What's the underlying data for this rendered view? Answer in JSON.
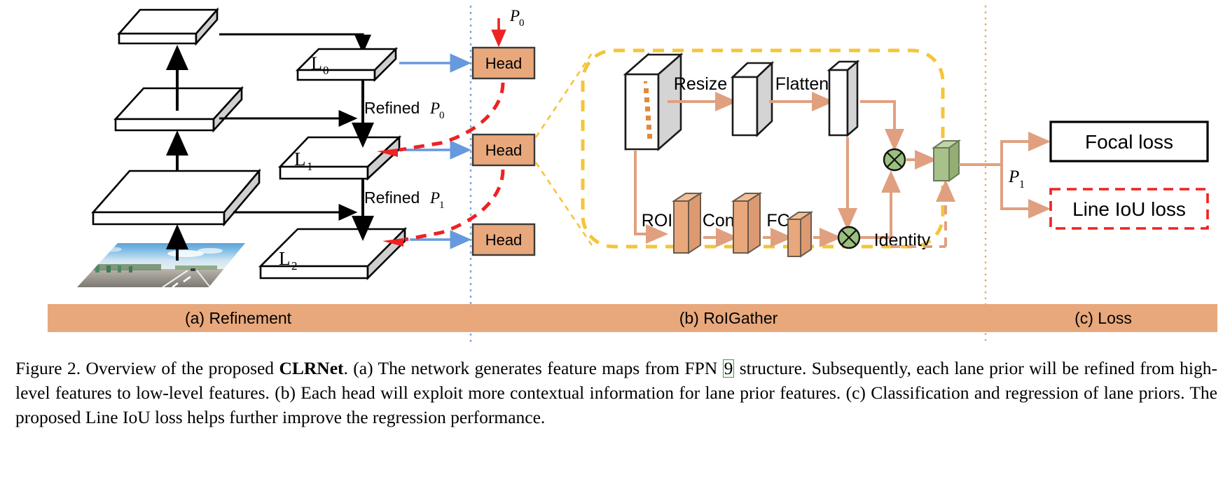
{
  "figure": {
    "number": "Figure 2.",
    "caption_part1": "Overview of the proposed ",
    "caption_bold": "CLRNet",
    "caption_part2": ". (a) The network generates feature maps from FPN ",
    "caption_ref": "9",
    "caption_part3": " structure. Subsequently, each lane prior will be refined from high-level features to low-level features. (b) Each head will exploit more contextual information for lane prior features. (c) Classification and regression of lane priors. The proposed Line IoU loss helps further improve the regression performance."
  },
  "sections": [
    {
      "id": "a",
      "label": "(a) Refinement"
    },
    {
      "id": "b",
      "label": "(b) RoIGather"
    },
    {
      "id": "c",
      "label": "(c) Loss"
    }
  ],
  "panel_a": {
    "fpn_levels": [
      "L_0",
      "L_1",
      "L_2"
    ],
    "level_labels": [
      {
        "base": "L",
        "sub": "0"
      },
      {
        "base": "L",
        "sub": "1"
      },
      {
        "base": "L",
        "sub": "2"
      }
    ],
    "heads": [
      "Head",
      "Head",
      "Head"
    ],
    "prior_input": {
      "base": "P",
      "sub": "0"
    },
    "refined_labels": [
      {
        "prefix": "Refined ",
        "base": "P",
        "sub": "0"
      },
      {
        "prefix": "Refined ",
        "base": "P",
        "sub": "1"
      }
    ],
    "input_image_alt": "highway-road-scene"
  },
  "panel_b": {
    "steps": [
      "Resize",
      "Flatten",
      "ROI",
      "Conv",
      "FC"
    ],
    "identity_label": "Identity",
    "multiply_symbol": "⊗"
  },
  "panel_c": {
    "output_prior": {
      "base": "P",
      "sub": "1"
    },
    "losses": [
      {
        "name": "Focal loss",
        "style": "solid"
      },
      {
        "name": "Line IoU loss",
        "style": "dashed"
      }
    ]
  },
  "colors": {
    "section_bar": "#e8a87c",
    "head_fill": "#e8a87c",
    "head_stroke": "#3a3a3a",
    "blue_arrow": "#6699dd",
    "red_dashed": "#ee2222",
    "gold_dashed": "#f5c43a",
    "salmon_arrow": "#e0a080",
    "green_node": "#9bbf7e",
    "green_box": "#a8c08a",
    "gray_face": "#d4d4d4",
    "dotted_divider_blue": "#7aa8dd",
    "dotted_divider_orange": "#e6a86a",
    "ref_link": "#2ea32e"
  }
}
